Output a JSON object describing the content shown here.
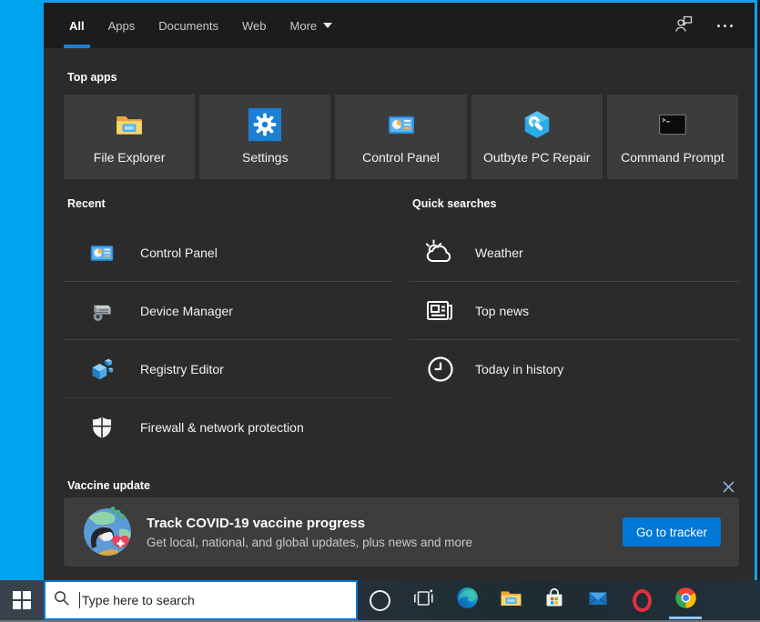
{
  "colors": {
    "desktop_blue": "#00a3ee",
    "panel_bg": "#2b2b2b",
    "nav_bg": "#1c1c1c",
    "tile_bg": "#3c3c3c",
    "accent_blue": "#0078d7",
    "tab_underline": "#1b7fd4",
    "close_x": "#8fb0d8",
    "chrome_underline": "#8ec8f5"
  },
  "nav": {
    "tabs": [
      {
        "label": "All",
        "active": true
      },
      {
        "label": "Apps",
        "active": false
      },
      {
        "label": "Documents",
        "active": false
      },
      {
        "label": "Web",
        "active": false
      },
      {
        "label": "More",
        "active": false,
        "has_dropdown": true
      }
    ],
    "icons": [
      "account-feedback-icon",
      "ellipsis-icon"
    ]
  },
  "top_apps": {
    "title": "Top apps",
    "tiles": [
      {
        "label": "File Explorer",
        "icon": "file-explorer-icon"
      },
      {
        "label": "Settings",
        "icon": "settings-gear-icon"
      },
      {
        "label": "Control Panel",
        "icon": "control-panel-icon"
      },
      {
        "label": "Outbyte PC Repair",
        "icon": "outbyte-pc-repair-icon"
      },
      {
        "label": "Command Prompt",
        "icon": "command-prompt-icon"
      }
    ]
  },
  "recent": {
    "title": "Recent",
    "items": [
      {
        "label": "Control Panel",
        "icon": "control-panel-icon"
      },
      {
        "label": "Device Manager",
        "icon": "device-manager-icon"
      },
      {
        "label": "Registry Editor",
        "icon": "registry-editor-icon"
      },
      {
        "label": "Firewall & network protection",
        "icon": "firewall-shield-icon"
      }
    ]
  },
  "quick_searches": {
    "title": "Quick searches",
    "items": [
      {
        "label": "Weather",
        "icon": "weather-icon"
      },
      {
        "label": "Top news",
        "icon": "news-icon"
      },
      {
        "label": "Today in history",
        "icon": "history-clock-icon"
      }
    ]
  },
  "vaccine": {
    "section_title": "Vaccine update",
    "card_title": "Track COVID-19 vaccine progress",
    "card_subtitle": "Get local, national, and global updates, plus news and more",
    "button_label": "Go to tracker",
    "close_icon": "close-icon",
    "image": "covid-vaccine-illustration"
  },
  "taskbar": {
    "search_placeholder": "Type here to search",
    "icons": [
      "start",
      "cortana",
      "task-view",
      "edge",
      "file-explorer",
      "store",
      "mail",
      "opera",
      "chrome"
    ],
    "active_icon": "chrome"
  }
}
